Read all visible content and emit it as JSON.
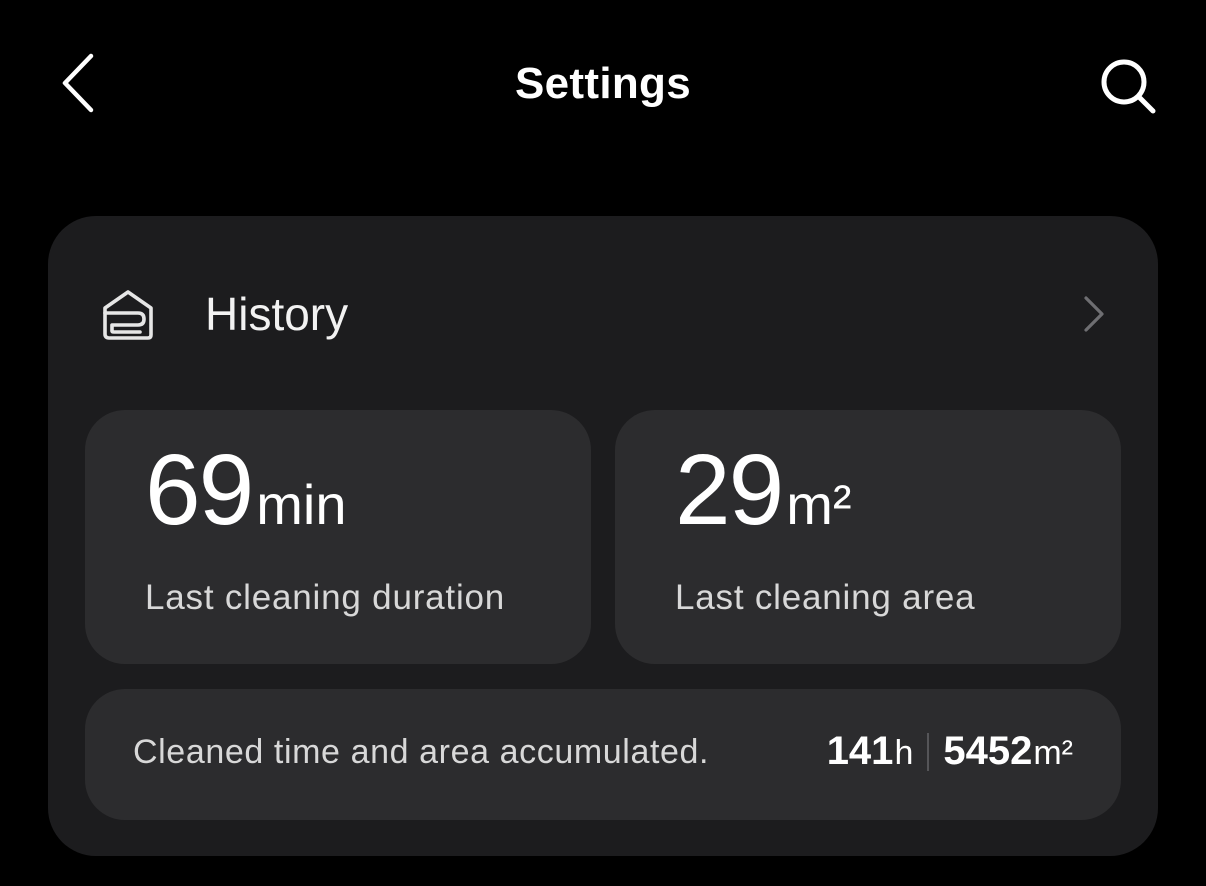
{
  "header": {
    "title": "Settings"
  },
  "history": {
    "label": "History"
  },
  "stats": {
    "duration": {
      "value": "69",
      "unit": "min",
      "caption": "Last cleaning duration"
    },
    "area": {
      "value": "29",
      "unit": "m²",
      "caption": "Last cleaning area"
    }
  },
  "accumulated": {
    "text": "Cleaned time and area accumulated.",
    "time_value": "141",
    "time_unit": "h",
    "area_value": "5452",
    "area_unit": "m²"
  },
  "icons": {
    "back": "chevron-left-icon",
    "search": "search-icon",
    "history": "history-house-icon",
    "chevron": "chevron-right-icon"
  },
  "colors": {
    "background": "#000000",
    "card": "#1c1c1e",
    "tile": "#2c2c2e",
    "text_primary": "#ffffff",
    "text_secondary": "#d8d8d8"
  }
}
